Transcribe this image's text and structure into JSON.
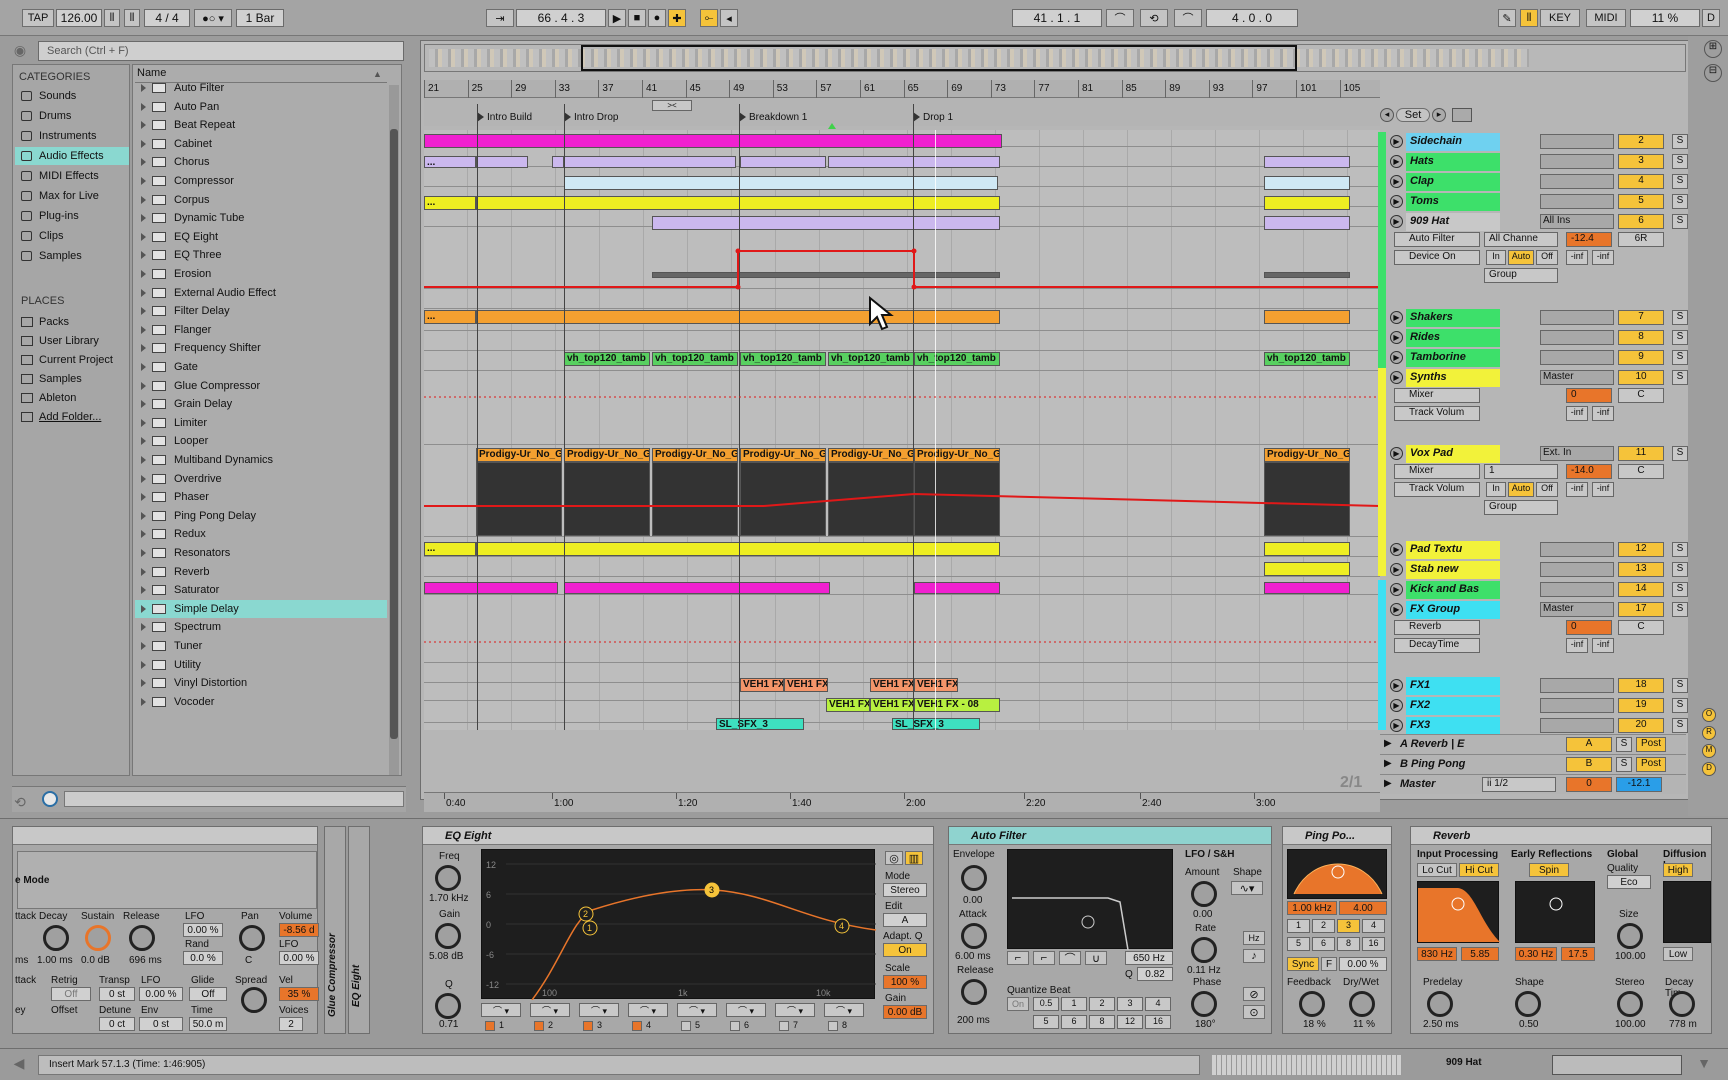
{
  "transport": {
    "tap": "TAP",
    "tempo": "126.00",
    "time_sig": "4 / 4",
    "quantize": "1 Bar",
    "position": "66 .  4 .  3",
    "loop_start": "41 .  1 .  1",
    "loop_length": "4 .  0 .  0",
    "key_label": "KEY",
    "midi_label": "MIDI",
    "cpu": "11 %",
    "disk": "D"
  },
  "browser": {
    "search_placeholder": "Search (Ctrl + F)",
    "categories_title": "CATEGORIES",
    "categories": [
      {
        "label": "Sounds",
        "icon": "note-icon"
      },
      {
        "label": "Drums",
        "icon": "grid-icon"
      },
      {
        "label": "Instruments",
        "icon": "instrument-icon"
      },
      {
        "label": "Audio Effects",
        "icon": "audio-effects-icon"
      },
      {
        "label": "MIDI Effects",
        "icon": "midi-effects-icon"
      },
      {
        "label": "Max for Live",
        "icon": "max-icon"
      },
      {
        "label": "Plug-ins",
        "icon": "plugin-icon"
      },
      {
        "label": "Clips",
        "icon": "clip-icon"
      },
      {
        "label": "Samples",
        "icon": "wave-icon"
      }
    ],
    "places_title": "PLACES",
    "places": [
      "Packs",
      "User Library",
      "Current Project",
      "Samples",
      "Ableton",
      "Add Folder..."
    ],
    "name_header": "Name",
    "items": [
      "Auto Filter",
      "Auto Pan",
      "Beat Repeat",
      "Cabinet",
      "Chorus",
      "Compressor",
      "Corpus",
      "Dynamic Tube",
      "EQ Eight",
      "EQ Three",
      "Erosion",
      "External Audio Effect",
      "Filter Delay",
      "Flanger",
      "Frequency Shifter",
      "Gate",
      "Glue Compressor",
      "Grain Delay",
      "Limiter",
      "Looper",
      "Multiband Dynamics",
      "Overdrive",
      "Phaser",
      "Ping Pong Delay",
      "Redux",
      "Resonators",
      "Reverb",
      "Saturator",
      "Simple Delay",
      "Spectrum",
      "Tuner",
      "Utility",
      "Vinyl Distortion",
      "Vocoder"
    ],
    "selected_item": "Simple Delay"
  },
  "arrangement": {
    "bar_numbers": [
      "21",
      "25",
      "29",
      "33",
      "37",
      "41",
      "45",
      "49",
      "53",
      "57",
      "61",
      "65",
      "69",
      "73",
      "77",
      "81",
      "85",
      "89",
      "93",
      "97",
      "101",
      "105"
    ],
    "locators": [
      "Intro Build",
      "Intro Drop",
      "Breakdown 1",
      "Drop 1"
    ],
    "time_ruler": [
      "0:40",
      "1:00",
      "1:20",
      "1:40",
      "2:00",
      "2:20",
      "2:40",
      "3:00"
    ],
    "page": "2/1",
    "set_label": "Set",
    "clip_names": {
      "tambo": "vh_top120_tamb",
      "prodigy": "Prodigy-Ur_No_G",
      "fx1": "VEH1 FX",
      "fx2": "VEH1 FX - 08",
      "sfx": "SL_SFX_3",
      "dots": "..."
    }
  },
  "tracks": [
    {
      "name": "Sidechain",
      "num": "2",
      "color": "#6fd1f0"
    },
    {
      "name": "Hats",
      "num": "3",
      "color": "#3de06a"
    },
    {
      "name": "Clap",
      "num": "4",
      "color": "#3de06a"
    },
    {
      "name": "Toms",
      "num": "5",
      "color": "#3de06a"
    },
    {
      "name": "909 Hat",
      "num": "6",
      "color": "#c8c8c8",
      "input": "All Ins",
      "channel": "All Channe",
      "vol": "-12.4",
      "pan": "6R",
      "device": "Auto Filter",
      "param": "Device On",
      "group": "Group"
    },
    {
      "name": "Shakers",
      "num": "7",
      "color": "#3de06a"
    },
    {
      "name": "Rides",
      "num": "8",
      "color": "#3de06a"
    },
    {
      "name": "Tamborine",
      "num": "9",
      "color": "#3de06a"
    },
    {
      "name": "Synths",
      "num": "10",
      "color": "#f2f23a",
      "output": "Master",
      "vol": "0",
      "pan": "C",
      "device": "Mixer",
      "param": "Track Volum"
    },
    {
      "name": "Vox Pad",
      "num": "11",
      "color": "#f2f23a",
      "input": "Ext. In",
      "channel": "1",
      "vol": "-14.0",
      "pan": "C",
      "device": "Mixer",
      "param": "Track Volum",
      "group": "Group"
    },
    {
      "name": "Pad Textu",
      "num": "12",
      "color": "#f2f23a"
    },
    {
      "name": "Stab new",
      "num": "13",
      "color": "#f2f23a"
    },
    {
      "name": "Kick and Bas",
      "num": "14",
      "color": "#3de06a"
    },
    {
      "name": "FX Group",
      "num": "17",
      "color": "#3ee0f2",
      "output": "Master",
      "vol": "0",
      "pan": "C",
      "device": "Reverb",
      "param": "DecayTime"
    },
    {
      "name": "FX1",
      "num": "18",
      "color": "#3ee0f2"
    },
    {
      "name": "FX2",
      "num": "19",
      "color": "#3ee0f2"
    },
    {
      "name": "FX3",
      "num": "20",
      "color": "#3ee0f2"
    }
  ],
  "returns": [
    {
      "name": "A Reverb | E",
      "num": "A",
      "post": "Post"
    },
    {
      "name": "B Ping Pong",
      "num": "B",
      "post": "Post"
    },
    {
      "name": "Master",
      "num": "0",
      "route": "ii 1/2",
      "vol": "-12.1"
    }
  ],
  "mix_labels": {
    "s": "S",
    "in": "In",
    "auto": "Auto",
    "off": "Off",
    "inf": "-inf"
  },
  "devices": {
    "simpler": {
      "mode": "e Mode",
      "decay": "Decay",
      "sustain": "Sustain",
      "release": "Release",
      "lfo": "LFO",
      "pan": "Pan",
      "volume": "Volume",
      "vals": {
        "decay": "1.00 ms",
        "sustain": "0.0 dB",
        "release": "696 ms",
        "lfo": "0.00 %",
        "rand": "0.0 %",
        "pan": "C",
        "volume": "-8.56 d",
        "lfo2": "0.00 %",
        "vel": "35 %",
        "voices": "2"
      },
      "labels2": {
        "attack": "ttack",
        "retrig": "Retrig",
        "transp": "Transp",
        "lfo": "LFO",
        "glide": "Glide",
        "spread": "Spread",
        "vel": "Vel",
        "key": "ey",
        "offset": "Offset",
        "detune": "Detune",
        "env": "Env",
        "time": "Time",
        "voices": "Voices",
        "rand": "Rand"
      },
      "vals2": {
        "retrig": "Off",
        "transp": "0 st",
        "lfo": "0.00 %",
        "glide": "Off",
        "spread": "0 %",
        "detune": "0 ct",
        "env": "0 st",
        "time": "50.0 m",
        "ms": "ms"
      }
    },
    "glue": "Glue Compressor",
    "eq_side": "EQ Eight",
    "eq": {
      "title": "EQ Eight",
      "freq": "Freq",
      "freq_val": "1.70 kHz",
      "gain": "Gain",
      "gain_val": "5.08 dB",
      "q": "Q",
      "q_val": "0.71",
      "mode": "Mode",
      "mode_val": "Stereo",
      "edit": "Edit",
      "edit_val": "A",
      "adapt": "Adapt. Q",
      "adapt_val": "On",
      "scale": "Scale",
      "scale_val": "100 %",
      "gain2": "Gain",
      "gain2_val": "0.00 dB",
      "y_ticks": [
        "12",
        "6",
        "0",
        "-6",
        "-12"
      ],
      "x_ticks": [
        "100",
        "1k",
        "10k"
      ],
      "bands": [
        "1",
        "2",
        "3",
        "4",
        "5",
        "6",
        "7",
        "8"
      ]
    },
    "autofilter": {
      "title": "Auto Filter",
      "envelope": "Envelope",
      "env_val": "0.00",
      "attack": "Attack",
      "attack_val": "6.00 ms",
      "release": "Release",
      "release_val": "200 ms",
      "freq_val": "650 Hz",
      "q_label": "Q",
      "q_val": "0.82",
      "quant": "Quantize Beat",
      "q_on": "On",
      "q_grid": [
        "0.5",
        "1",
        "2",
        "3",
        "4",
        "5",
        "6",
        "8",
        "12",
        "16"
      ],
      "lfo": "LFO / S&H",
      "amount": "Amount",
      "amount_val": "0.00",
      "shape": "Shape",
      "rate": "Rate",
      "rate_val": "0.11 Hz",
      "phase": "Phase",
      "phase_val": "180°",
      "hz": "Hz"
    },
    "pingpong": {
      "title": "Ping Po...",
      "freq_val": "1.00 kHz",
      "q_val": "4.00",
      "grid": [
        "1",
        "2",
        "3",
        "4",
        "5",
        "6",
        "8",
        "16"
      ],
      "sync": "Sync",
      "f": "F",
      "pct": "0.00 %",
      "feedback": "Feedback",
      "feedback_val": "18 %",
      "drywet": "Dry/Wet",
      "drywet_val": "11 %"
    },
    "reverb": {
      "title": "Reverb",
      "input": "Input Processing",
      "locut": "Lo Cut",
      "hicut": "Hi Cut",
      "early": "Early Reflections",
      "spin": "Spin",
      "global": "Global",
      "quality": "Quality",
      "quality_val": "Eco",
      "size": "Size",
      "size_val": "100.00",
      "diffusion": "Diffusion I",
      "high": "High",
      "low": "Low",
      "in_freq": "830 Hz",
      "in_q": "5.85",
      "er_freq": "0.30 Hz",
      "er_amt": "17.5",
      "predelay": "Predelay",
      "predelay_val": "2.50 ms",
      "shape": "Shape",
      "shape_val": "0.50",
      "stereo": "Stereo",
      "stereo_val": "100.00",
      "decay": "Decay Tim",
      "decay_val": "778 m"
    }
  },
  "status": {
    "text": "Insert Mark 57.1.3 (Time: 1:46:905)",
    "track": "909 Hat"
  }
}
